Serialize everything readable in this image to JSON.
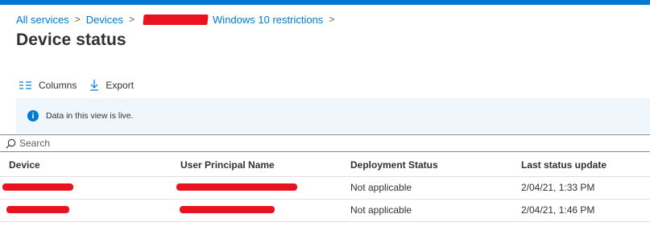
{
  "colors": {
    "accent": "#0078d4",
    "redaction": "#e8131f",
    "info_banner_bg": "#eff6fc"
  },
  "breadcrumb": {
    "items": [
      {
        "label": "All services"
      },
      {
        "label": "Devices"
      },
      {
        "label": ""
      },
      {
        "label": "Windows 10 restrictions"
      }
    ],
    "separator": ">"
  },
  "page": {
    "title": "Device status"
  },
  "toolbar": {
    "columns_label": "Columns",
    "columns_icon": "columns-icon",
    "export_label": "Export",
    "export_icon": "download-arrow-icon"
  },
  "banner": {
    "icon": "info-icon",
    "icon_glyph": "i",
    "text": "Data in this view is live."
  },
  "search": {
    "placeholder": "Search",
    "icon": "search-icon"
  },
  "table": {
    "headers": {
      "device": "Device",
      "upn": "User Principal Name",
      "deployment_status": "Deployment Status",
      "last_status_update": "Last status update"
    },
    "rows": [
      {
        "device": "",
        "upn": "",
        "deployment_status": "Not applicable",
        "last_status_update": "2/04/21, 1:33 PM"
      },
      {
        "device": "",
        "upn": "",
        "deployment_status": "Not applicable",
        "last_status_update": "2/04/21, 1:46 PM"
      }
    ]
  }
}
